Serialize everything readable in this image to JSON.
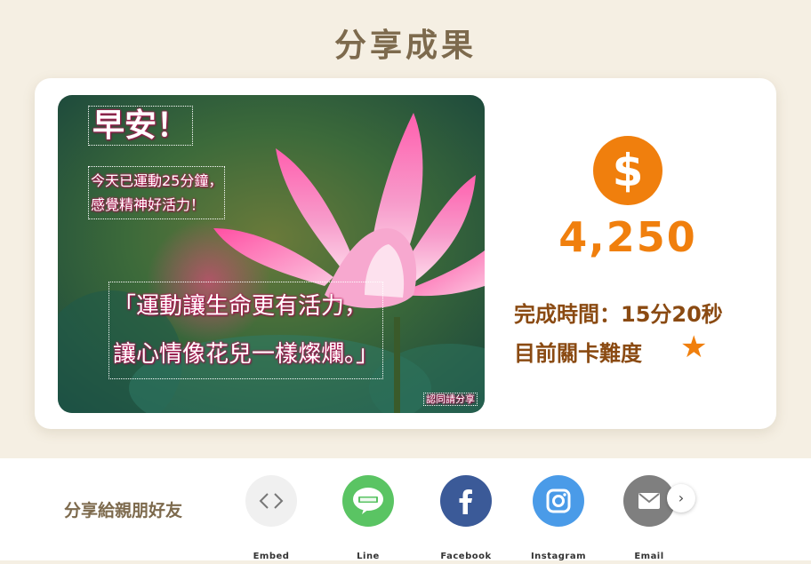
{
  "page": {
    "title": "分享成果"
  },
  "photo": {
    "greeting": "早安！",
    "body_line1": "今天已運動25分鐘，",
    "body_line2": "感覺精神好活力！",
    "quote_line1": "「運動讓生命更有活力，",
    "quote_line2": "讓心情像花兒一樣燦爛。」",
    "share_tag": "認同請分享"
  },
  "result": {
    "coin_symbol": "$",
    "score": "4,250",
    "time_label": "完成時間：15分20秒",
    "level_label": "目前關卡難度",
    "level_stars": "★",
    "level_value": 1
  },
  "share": {
    "label": "分享給親朋好友",
    "buttons": [
      {
        "label": "Embed",
        "icon": "embed-icon",
        "color": "#f0f0f0"
      },
      {
        "label": "Line",
        "icon": "line-icon",
        "color": "#5ac463"
      },
      {
        "label": "Facebook",
        "icon": "facebook-icon",
        "color": "#3b5a98"
      },
      {
        "label": "Instagram",
        "icon": "instagram-icon",
        "color": "#4a9be8"
      },
      {
        "label": "Email",
        "icon": "email-icon",
        "color": "#7f7f7f"
      }
    ],
    "next_icon": "chevron-right-icon"
  },
  "colors": {
    "background": "#f5efe3",
    "accent": "#f07f0d",
    "title": "#7d6a4d",
    "stats_text": "#8a4a12"
  }
}
